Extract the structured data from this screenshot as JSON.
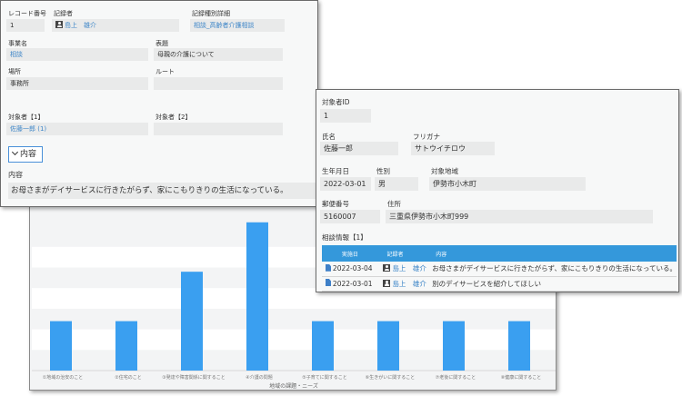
{
  "record": {
    "record_no_label": "レコード番号",
    "record_no": "1",
    "recorder_label": "記録者",
    "recorder": "島上　雄介",
    "record_type_label": "記録種別詳細",
    "record_type": "相談_高齢者介護相談",
    "business_label": "事業名",
    "business": "相談",
    "title_label": "表題",
    "title": "母親の介護について",
    "place_label": "場所",
    "place": "事務所",
    "route_label": "ルート",
    "route": "",
    "subject1_label": "対象者【1】",
    "subject1": "佐藤一郎 (1)",
    "subject2_label": "対象者【2】",
    "subject2": "",
    "toggle_label": "内容",
    "content_label": "内容",
    "content": "お母さまがデイサービスに行きたがらず、家にこもりきりの生活になっている。"
  },
  "subject": {
    "id_label": "対象者ID",
    "id": "1",
    "name_label": "氏名",
    "name": "佐藤一郎",
    "kana_label": "フリガナ",
    "kana": "サトウイチロウ",
    "birth_label": "生年月日",
    "birth": "2022-03-01",
    "gender_label": "性別",
    "gender": "男",
    "area_label": "対象地域",
    "area": "伊勢市小木町",
    "zip_label": "郵便番号",
    "zip": "5160007",
    "address_label": "住所",
    "address": "三重県伊勢市小木町999",
    "table_title": "相談情報【1】",
    "table_headers": [
      "実施日",
      "記録者",
      "内容"
    ],
    "rows": [
      {
        "date": "2022-03-04",
        "recorder": "島上　雄介",
        "content": "お母さまがデイサービスに行きたがらず、家にこもりきりの生活になっている。"
      },
      {
        "date": "2022-03-01",
        "recorder": "島上　雄介",
        "content": "別のデイサービスを紹介してほしい"
      }
    ]
  },
  "colors": {
    "bar": "#3a9ff0",
    "table_header": "#3498db",
    "link": "#3e86c8"
  },
  "chart_data": {
    "type": "bar",
    "xlabel": "地域の課題・ニーズ",
    "categories": [
      "①地域の治安のこと",
      "②住宅のこと",
      "③発達や障害関係に関すること",
      "④介護の問題",
      "⑤子育てに関すること",
      "⑥生きがいに関すること",
      "⑦老後に関すること",
      "⑧健康に関すること"
    ],
    "values": [
      1,
      1,
      2,
      3,
      1,
      1,
      1,
      1
    ],
    "ylim": [
      0,
      3.4
    ],
    "grid": true
  }
}
